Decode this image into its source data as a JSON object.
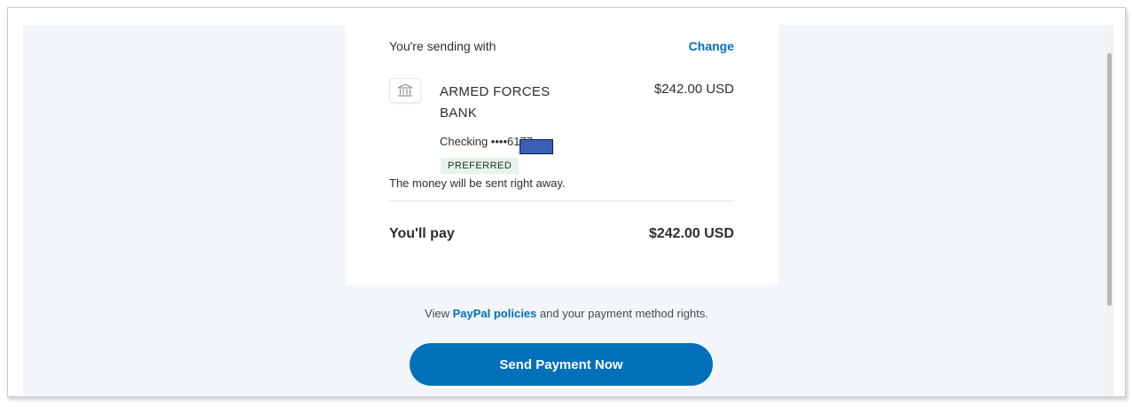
{
  "payment": {
    "sending_with_label": "You're sending with",
    "change_label": "Change",
    "bank_name": "ARMED FORCES BANK",
    "amount": "$242.00 USD",
    "account_label": "Checking ••••6177",
    "preferred_badge": "PREFERRED",
    "sent_note": "The money will be sent right away.",
    "you_pay_label": "You'll pay",
    "you_pay_amount": "$242.00 USD"
  },
  "footer": {
    "policies_prefix": "View ",
    "policies_link": "PayPal policies",
    "policies_suffix": " and your payment method rights.",
    "send_button": "Send Payment Now"
  },
  "icons": {
    "bank": "bank-icon"
  },
  "colors": {
    "link": "#0070ba",
    "button": "#0070ba",
    "badge_bg": "#e5f4e9",
    "page_bg": "#f2f5f9"
  }
}
